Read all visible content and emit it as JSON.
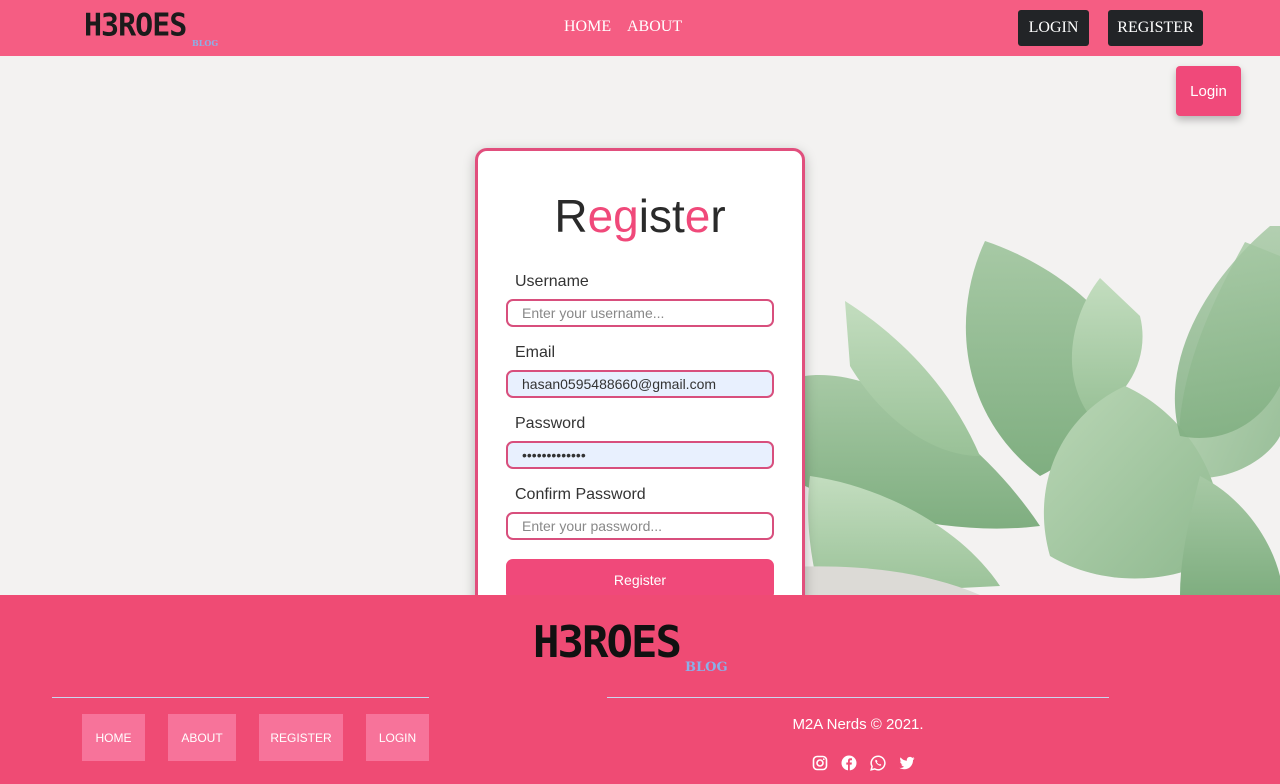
{
  "header": {
    "logo_main": "H3ROES",
    "logo_sub": "BLOG",
    "nav": {
      "home": "HOME",
      "about": "ABOUT"
    },
    "login_label": "LOGIN",
    "register_label": "REGISTER"
  },
  "floating_login": "Login",
  "form": {
    "title_parts": [
      "R",
      "eg",
      "ist",
      "e",
      "r"
    ],
    "username": {
      "label": "Username",
      "placeholder": "Enter your username..."
    },
    "email": {
      "label": "Email",
      "value": "hasan0595488660@gmail.com"
    },
    "password": {
      "label": "Password",
      "value": "•••••••••••••"
    },
    "confirm": {
      "label": "Confirm Password",
      "placeholder": "Enter your password..."
    },
    "submit_label": "Register"
  },
  "footer": {
    "logo_main": "H3ROES",
    "logo_sub": "BLOG",
    "links": {
      "home": "HOME",
      "about": "ABOUT",
      "register": "REGISTER",
      "login": "LOGIN"
    },
    "copyright": "M2A Nerds © 2021.",
    "social_icons": [
      "instagram-icon",
      "facebook-icon",
      "whatsapp-icon",
      "twitter-icon"
    ]
  },
  "colors": {
    "header_bg": "#f55d83",
    "accent": "#f0497a",
    "card_border": "#e14f7d",
    "footer_bg": "#ef4b74",
    "dark_button": "#222427"
  }
}
